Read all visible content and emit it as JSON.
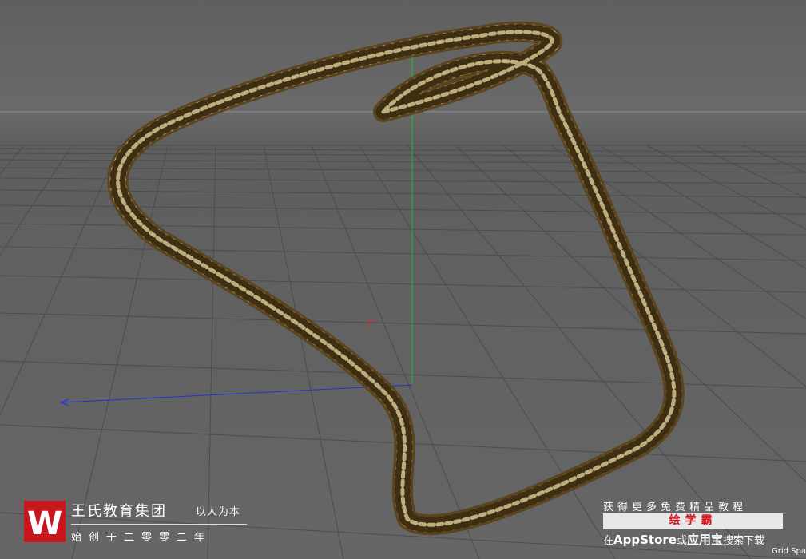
{
  "viewport": {
    "grid_label": "Grid Spa",
    "colors": {
      "axis_y": "#19c21c",
      "axis_z": "#2330d8",
      "axis_x": "#d42a2a",
      "chain": "#c9b06a"
    }
  },
  "watermark": {
    "logo_letter": "W",
    "title": "王氏教育集团",
    "slogan": "以人为本",
    "subtitle": "始创于二零零二年"
  },
  "promo": {
    "line1": "获得更多免费精品教程",
    "app_name": "绘学霸",
    "line3_prefix": "在",
    "line3_store": "AppStore",
    "line3_mid": "或",
    "line3_app": "应用宝",
    "line3_suffix": "搜索下载"
  }
}
